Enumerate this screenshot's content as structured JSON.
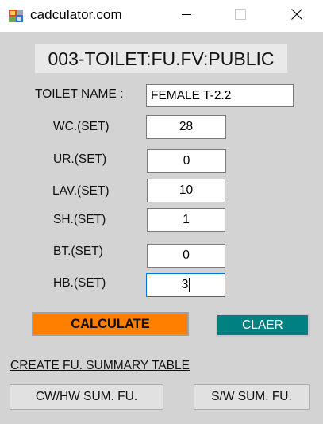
{
  "window": {
    "title": "cadculator.com",
    "icon": "app-grid-icon",
    "controls": [
      "minimize-icon",
      "maximize-icon",
      "close-icon"
    ]
  },
  "header": {
    "title": "003-TOILET:FU.FV:PUBLIC"
  },
  "form": {
    "toilet_name_label": "TOILET NAME :",
    "toilet_name_value": "FEMALE T-2.2",
    "fields": [
      {
        "label": "WC.(SET)",
        "value": "28"
      },
      {
        "label": "UR.(SET)",
        "value": "0"
      },
      {
        "label": "LAV.(SET)",
        "value": "10"
      },
      {
        "label": "SH.(SET)",
        "value": "1"
      },
      {
        "label": "BT.(SET)",
        "value": "0"
      },
      {
        "label": "HB.(SET)",
        "value": "3"
      }
    ]
  },
  "buttons": {
    "calculate": "CALCULATE",
    "clear": "CLAER",
    "summary_link": "CREATE FU. SUMMARY TABLE",
    "cw_hw": "CW/HW SUM. FU.",
    "sw": "S/W SUM. FU."
  },
  "colors": {
    "calculate_bg": "#ff7f00",
    "clear_bg": "#008080",
    "client_bg": "#d3d3d3",
    "focus_border": "#0078d7"
  }
}
